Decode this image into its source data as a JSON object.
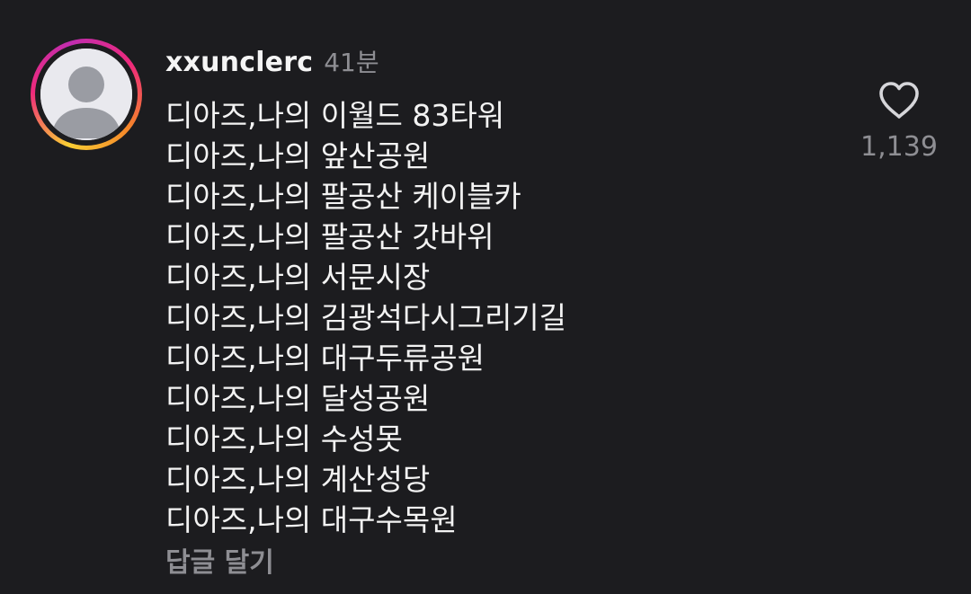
{
  "comment": {
    "username": "xxunclerc",
    "time_ago": "41분",
    "lines": [
      "디아즈,나의 이월드 83타워",
      "디아즈,나의 앞산공원",
      "디아즈,나의 팔공산 케이블카",
      "디아즈,나의 팔공산 갓바위",
      "디아즈,나의 서문시장",
      "디아즈,나의 김광석다시그리기길",
      "디아즈,나의 대구두류공원",
      "디아즈,나의 달성공원",
      "디아즈,나의 수성못",
      "디아즈,나의 계산성당",
      "디아즈,나의 대구수목원"
    ],
    "reply_label": "답글 달기",
    "like_count": "1,139",
    "like_icon": "heart-outline-icon",
    "avatar_icon": "default-user-avatar-icon"
  },
  "colors": {
    "background": "#1c1c1f",
    "text": "#f3f3f3",
    "muted": "#8e8e93",
    "story_ring_gradient": [
      "#f9ce34",
      "#ee2a7b",
      "#c02db0",
      "#f58529"
    ]
  }
}
